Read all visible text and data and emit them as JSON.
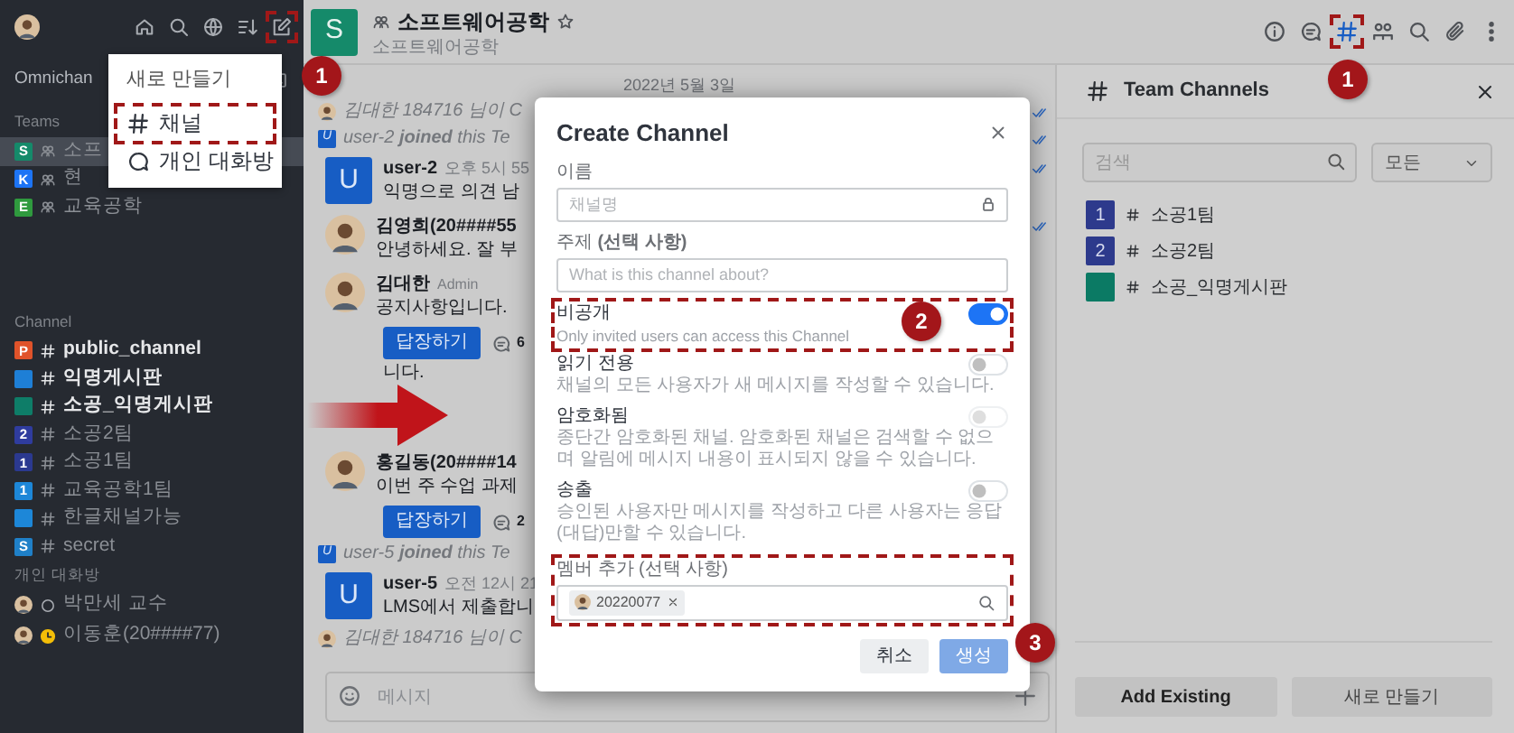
{
  "sidebar": {
    "omnichannel": "Omnichan",
    "teams_heading": "Teams",
    "teams": [
      {
        "badge": "S",
        "name": "소프",
        "color": "#158a6a",
        "selected": true
      },
      {
        "badge": "K",
        "name": "현",
        "color": "#1d74f5",
        "selected": false
      },
      {
        "badge": "E",
        "name": "교육공학",
        "color": "#2f9a3e",
        "selected": false
      }
    ],
    "channels_heading": "Channel",
    "channels": [
      {
        "badge": "P",
        "name": "public_channel",
        "color": "#e0532a",
        "unread": true
      },
      {
        "name": "익명게시판",
        "color": "#1e7fd6",
        "unread": true
      },
      {
        "name": "소공_익명게시판",
        "color": "#0e7d68",
        "unread": true
      },
      {
        "badge": "2",
        "name": "소공2팀",
        "color": "#2f3c9e",
        "unread": false
      },
      {
        "badge": "1",
        "name": "소공1팀",
        "color": "#2b3990",
        "unread": false
      },
      {
        "badge": "1",
        "name": "교육공학1팀",
        "color": "#1d87d8",
        "unread": false
      },
      {
        "name": "한글채널가능",
        "color": "#1d87d8",
        "unread": false
      },
      {
        "badge": "S",
        "name": "secret",
        "color": "#1f80c8",
        "unread": false
      }
    ],
    "direct_heading": "개인 대화방",
    "direct": [
      {
        "name": "박만세 교수",
        "kind": "offline"
      },
      {
        "name": "이동훈(20####77)",
        "kind": "away"
      }
    ]
  },
  "new_menu": {
    "title": "새로 만들기",
    "items": [
      {
        "kind": "channel",
        "label": "채널",
        "highlighted": true
      },
      {
        "kind": "direct",
        "label": "개인 대화방",
        "highlighted": false
      }
    ]
  },
  "room_header": {
    "avatar": "S",
    "color": "#158a6a",
    "title": "소프트웨어공학",
    "subtitle": "소프트웨어공학",
    "favorite": false
  },
  "chat": {
    "items": [
      {
        "kind": "date",
        "text": "2022년 5월 3일"
      },
      {
        "kind": "system",
        "text": "김대한 *184716 님이 C*",
        "read": true
      },
      {
        "kind": "system",
        "avatar_letter": "U",
        "text": "user-2 **joined** this Te",
        "read": true
      },
      {
        "kind": "message",
        "avatar_letter": "U",
        "author": "user-2",
        "time": "오후 5시 55",
        "text": "익명으로 의견 남",
        "read": true
      },
      {
        "kind": "message",
        "author": "김영희(20####55",
        "text": "안녕하세요. 잘 부",
        "read": true
      },
      {
        "kind": "message",
        "author": "김대한",
        "role": "Admin",
        "text": "공지사항입니다.",
        "read": false
      },
      {
        "kind": "reply",
        "button": "답장하기",
        "count": "6"
      },
      {
        "kind": "text",
        "text": "니다."
      },
      {
        "kind": "message",
        "author": "홍길동(20####14",
        "text": "이번 주 수업 과제",
        "read": false
      },
      {
        "kind": "reply",
        "button": "답장하기",
        "count": "2"
      },
      {
        "kind": "system",
        "avatar_letter": "U",
        "text": "user-5 **joined** this Te",
        "read": false
      },
      {
        "kind": "message",
        "avatar_letter": "U",
        "author": "user-5",
        "time": "오전 12시 21",
        "text": "LMS에서 제출합니",
        "read": false
      },
      {
        "kind": "system",
        "text": "김대한 *184716 님이 C*",
        "read": false
      }
    ],
    "composer_placeholder": "메시지"
  },
  "team_channels": {
    "title": "Team Channels",
    "search_placeholder": "검색",
    "filter": "모든",
    "channels": [
      {
        "badge": "1",
        "name": "소공1팀",
        "color": "#2d3a8c"
      },
      {
        "badge": "2",
        "name": "소공2팀",
        "color": "#2d3a8c"
      },
      {
        "name": "소공_익명게시판",
        "color": "#0b7a64"
      }
    ],
    "buttons": [
      "Add Existing",
      "새로 만들기"
    ]
  },
  "modal": {
    "title": "Create Channel",
    "fields": [
      {
        "label": "이름",
        "placeholder": "채널명",
        "locked": true
      },
      {
        "label": "주제 **(선택 사항)**",
        "placeholder": "What is this channel about?",
        "locked": false
      }
    ],
    "settings": [
      {
        "label": "비공개",
        "description": "Only invited users can access this Channel",
        "on": true,
        "disabled": false
      },
      {
        "label": "읽기 전용",
        "description": "채널의 모든 사용자가 새 메시지를 작성할 수 있습니다.",
        "on": false,
        "disabled": false
      },
      {
        "label": "암호화됨",
        "description": "종단간 암호화된 채널. 암호화된 채널은 검색할 수 없으며 알림에 메시지 내용이 표시되지 않을 수 있습니다.",
        "on": false,
        "disabled": true
      },
      {
        "label": "송출",
        "description": "승인된 사용자만 메시지를 작성하고 다른 사용자는 응답(대답)만할 수 있습니다.",
        "on": false,
        "disabled": false
      }
    ],
    "members": {
      "label": "멤버 추가 (선택 사항)",
      "chips": [
        "20220077"
      ]
    },
    "buttons": [
      {
        "label": "취소",
        "kind": "secondary"
      },
      {
        "label": "생성",
        "kind": "primary",
        "disabled": true
      }
    ]
  },
  "annotations": [
    {
      "number": "1"
    },
    {
      "number": "1"
    },
    {
      "number": "2"
    },
    {
      "number": "3"
    }
  ]
}
